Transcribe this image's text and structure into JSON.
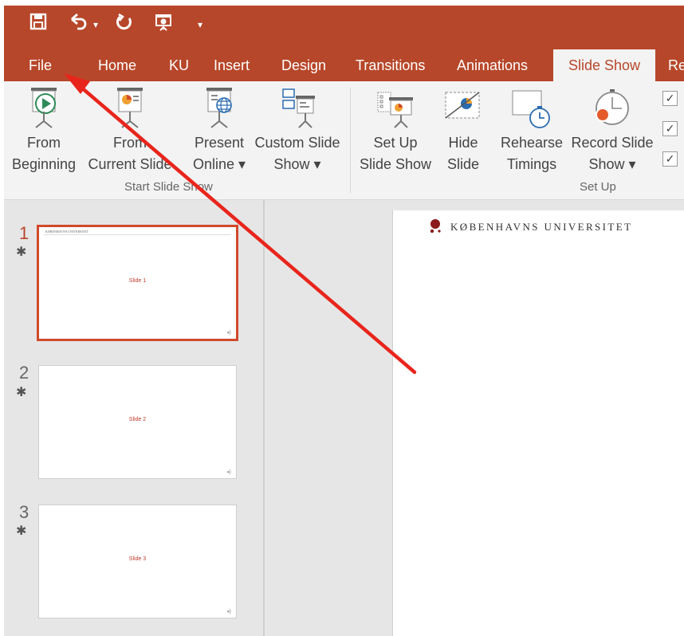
{
  "tabs": [
    {
      "label": "File"
    },
    {
      "label": "Home"
    },
    {
      "label": "KU"
    },
    {
      "label": "Insert"
    },
    {
      "label": "Design"
    },
    {
      "label": "Transitions"
    },
    {
      "label": "Animations"
    },
    {
      "label": "Slide Show",
      "active": true
    },
    {
      "label": "Re"
    }
  ],
  "ribbon": {
    "start": {
      "from_beginning": [
        "From",
        "Beginning"
      ],
      "from_current": [
        "From",
        "Current Slide"
      ],
      "present_online": [
        "Present",
        "Online ▾"
      ],
      "custom_show": [
        "Custom Slide",
        "Show ▾"
      ],
      "group_label": "Start Slide Show"
    },
    "setup": {
      "setup_show": [
        "Set Up",
        "Slide Show"
      ],
      "hide_slide": [
        "Hide",
        "Slide"
      ],
      "rehearse": [
        "Rehearse",
        "Timings"
      ],
      "record": [
        "Record Slide",
        "Show ▾"
      ],
      "group_label": "Set Up"
    }
  },
  "slides": [
    {
      "num": "1",
      "text": "Slide 1",
      "header": "KØBENHAVNS UNIVERSITET"
    },
    {
      "num": "2",
      "text": "Slide 2"
    },
    {
      "num": "3",
      "text": "Slide 3"
    }
  ],
  "canvas": {
    "brand": "KØBENHAVNS UNIVERSITET"
  },
  "colors": {
    "accent": "#b7472a",
    "annotation_arrow": "#e8251c"
  },
  "icons": {
    "save": "save-icon",
    "undo": "undo-icon",
    "redo": "redo-icon",
    "start_from_beginning": "present-from-start-icon",
    "customize": "customize-qat-icon"
  }
}
